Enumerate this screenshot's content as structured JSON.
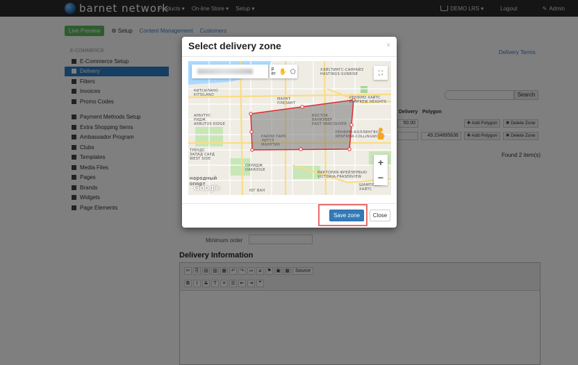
{
  "navbar": {
    "brand": "barnet network",
    "menu": [
      "Products ▾",
      "On-line Store ▾",
      "Setup ▾"
    ],
    "user": "DEMO LRS ▾",
    "logout": "Logout",
    "admin": "Admin"
  },
  "subnav": {
    "live_preview": "Live Preview",
    "setup": "Setup",
    "content_management": "Content Management",
    "customers": "Customers"
  },
  "sidebar": {
    "section_title": "E-COMMERCE",
    "items": [
      "E-Commerce Setup",
      "Delivery",
      "Filters",
      "Invoices",
      "Promo Codes",
      "Payment Methods Setup",
      "Extra Shopping Items",
      "Ambassador Program",
      "Clubs",
      "Templates",
      "Media Files",
      "Pages",
      "Brands",
      "Widgets",
      "Page Elements"
    ],
    "active_index": 1
  },
  "main": {
    "delivery_terms": "Delivery Terms",
    "search_button": "Search",
    "col_delivery": "Delivery",
    "col_polygon": "Polygon",
    "rows": [
      {
        "delivery": "50.00",
        "polygon": ""
      },
      {
        "delivery": "",
        "polygon": "49.234895636"
      }
    ],
    "add_polygon": "Add Polygon",
    "delete_zone": "Delete Zone",
    "found": "Found 2 item(s)",
    "minimum_order_label": "Minimum order",
    "delivery_information": "Delivery Information",
    "source_label": "Source"
  },
  "modal": {
    "title": "Select delivery zone",
    "close_x": "×",
    "save_button": "Save zone",
    "close_button": "Close",
    "map": {
      "labels": [
        "КИТСИЛАНО\nKITSILANO",
        "АРБУТУС\nРИДЖ\nARBUTUS RIDGE",
        "МАУНТ\nПЛЕЗАНТ",
        "ВОСТОК\nВАНКУВЕР\nEAST VANCOUVER",
        "ХЭЙСТИНГС-САНРАЙЗ\nHASTINGS-SUNRISE",
        "РЕНФРЮ ХАЙТС\nRENFREW HEIGHTS",
        "РЕНФРЮ-КОЛЛИНГВУД\nRENFREW-COLLINGWOOD",
        "РАЙЛИ ПАРК\nЛИТТЛ\nМАУНТИН",
        "ТРЕНДС\nЗАПАД САРД\nWEST SIDE",
        "ОКРИДЖ\nOAKRIDGE",
        "ВИКТОРИЯ-ФРЕЙЗЕРВЬЮ\nVICTORIA-FRASERVIEW",
        "ШАМПЛЕЙН\nХАЙТС",
        "народный\nопорт",
        "ЮГ ВАН"
      ],
      "search_partial": "р\ner",
      "logo": "Google"
    }
  }
}
